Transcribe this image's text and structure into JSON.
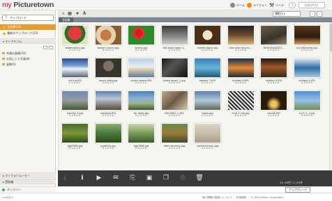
{
  "header": {
    "logo_prefix": "my ",
    "logo_main": "Picturetown",
    "home_label": "ホーム",
    "mypage_label": "マイフォト",
    "tools_label": "ツール",
    "help_label": "?",
    "logout_label": "ログアウト"
  },
  "sidebar": {
    "upload_label": "アップロード",
    "items": [
      {
        "label": "全画像(33)"
      },
      {
        "label": "最新のアップロード(33)"
      }
    ],
    "myalbum_label": "マイアルバム",
    "folders": [
      {
        "label": "共通の画像(33)"
      },
      {
        "label": "お気に入り写真(8)"
      },
      {
        "label": "風景(0)"
      }
    ],
    "my_movie_label": "マイフォトムービー",
    "shared_label": "受取箱",
    "online_label": "オンライン"
  },
  "toolbar": {
    "sort_label": "撮影日",
    "page_prev": "‹",
    "page_next": "›"
  },
  "album_tab": "全画像",
  "photos": [
    {
      "label": "watermelon.jpg"
    },
    {
      "label": "today's lunch.jpg"
    },
    {
      "label": "spring.jpg"
    },
    {
      "label": "old store Japan.J..."
    },
    {
      "label": "noodle japan.jpg"
    },
    {
      "label": "new year japan.J..."
    },
    {
      "label": "Mt.Kiritan2010..."
    },
    {
      "label": "my favourite.jpg"
    },
    {
      "label": "mt.fuji.JPG"
    },
    {
      "label": "lovely kitty.jpg"
    },
    {
      "label": "lovely beach.JPG"
    },
    {
      "label": "kyoto japan_1.jpg"
    },
    {
      "label": "holiday 7.JPG"
    },
    {
      "label": "holiday 6.JPG"
    },
    {
      "label": "holiday 5.JPG"
    },
    {
      "label": "holiday 4.JPG"
    },
    {
      "label": "holiday 3.jpg"
    },
    {
      "label": "holiday4.JPG"
    },
    {
      "label": "far away.jpg"
    },
    {
      "label": "DSC0002_1.JPG"
    },
    {
      "label": "dawn.jpg"
    },
    {
      "label": "chat 4 city.jpg"
    },
    {
      "label": "candle.JPG"
    },
    {
      "label": "b12_3_1.jpg"
    },
    {
      "label": "jpg0006.jpg"
    },
    {
      "label": "jpg0005.jpg"
    },
    {
      "label": "jpg0006.jpg"
    },
    {
      "label": "after working.jpg"
    },
    {
      "label": "centrichemon.jpg"
    }
  ],
  "bottombar": {
    "count_text": "33 /33件 / 1 /33件"
  },
  "upgrade_label": "アップグレード",
  "footer": {
    "user": "ruci0372",
    "text": "個人情報の取扱いについて  ｜ 利用規約  ｜ © 2010 Nikon Corporation"
  },
  "colors": {
    "accent": "#e79b2b",
    "bottombar": "#3a3a3a",
    "brand_red": "#d9001b"
  }
}
